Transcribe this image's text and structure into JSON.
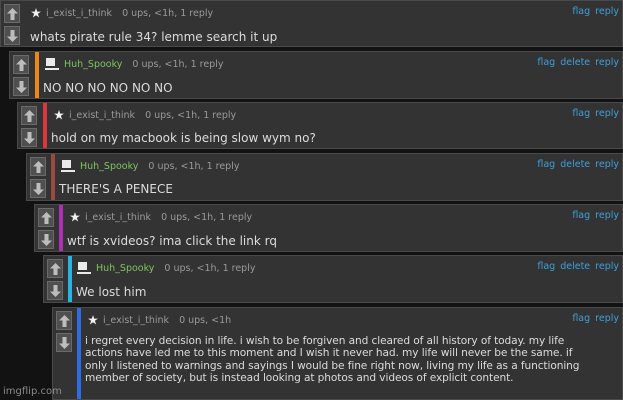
{
  "icons": {
    "upvote": "arrow-up-icon",
    "downvote": "arrow-down-icon",
    "featured_user": "star-icon",
    "regular_user": "user-icon"
  },
  "colors": {
    "link": "#3f9fd9",
    "username_green": "#7fc45f",
    "bar_orange": "#e8891a",
    "bar_red": "#d9363e",
    "bar_brown": "#9a4a3e",
    "bar_purple": "#b02fb5",
    "bar_cyan": "#26b6e6",
    "bar_blue": "#2e6be6"
  },
  "comments": [
    {
      "user": "i_exist_i_think",
      "stats": "0 ups, <1h, 1 reply",
      "text": "whats pirate rule 34? lemme search it up",
      "actions": {
        "flag": "flag",
        "reply": "reply"
      }
    },
    {
      "user": "Huh_Spooky",
      "stats": "0 ups, <1h, 1 reply",
      "text": "NO NO NO NO NO NO",
      "actions": {
        "flag": "flag",
        "delete": "delete",
        "reply": "reply"
      }
    },
    {
      "user": "i_exist_i_think",
      "stats": "0 ups, <1h, 1 reply",
      "text": "hold on my macbook is being slow wym no?",
      "actions": {
        "flag": "flag",
        "reply": "reply"
      }
    },
    {
      "user": "Huh_Spooky",
      "stats": "0 ups, <1h, 1 reply",
      "text": "THERE'S A PENECE",
      "actions": {
        "flag": "flag",
        "delete": "delete",
        "reply": "reply"
      }
    },
    {
      "user": "i_exist_i_think",
      "stats": "0 ups, <1h, 1 reply",
      "text": "wtf is xvideos? ima click the link rq",
      "actions": {
        "flag": "flag",
        "reply": "reply"
      }
    },
    {
      "user": "Huh_Spooky",
      "stats": "0 ups, <1h, 1 reply",
      "text": "We lost him",
      "actions": {
        "flag": "flag",
        "delete": "delete",
        "reply": "reply"
      }
    },
    {
      "user": "i_exist_i_think",
      "stats": "0 ups, <1h",
      "text_lines": [
        "i regret every decision in life. i wish to be forgiven and cleared of all history of today. my life",
        "actions have led me to this moment and I wish it never had. my life will never be the same. if",
        "only I listened to warnings and sayings I would be fine right now, living my life as a functioning",
        "member of society, but is instead looking at photos and videos of explicit content."
      ],
      "actions": {
        "flag": "flag",
        "reply": "reply"
      }
    }
  ],
  "watermark": "imgflip.com"
}
